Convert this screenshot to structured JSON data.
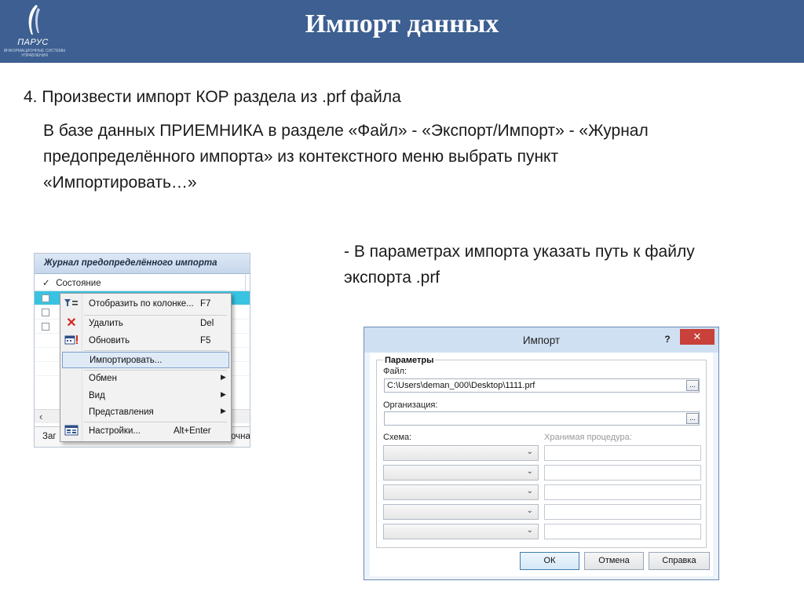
{
  "header": {
    "title": "Импорт данных",
    "logo": {
      "brand": "ПАРУС",
      "tagline": "ИНФОРМАЦИОННЫЕ СИСТЕМЫ УПРАВЛЕНИЯ"
    },
    "background": "#3d5f91"
  },
  "content": {
    "step": "4. Произвести импорт КОР раздела из .prf файла",
    "description_lines": [
      "В базе данных ПРИЕМНИКА в разделе «Файл» - «Экспорт/Импорт» - «Журнал",
      "предопределённого импорта» из контекстного меню выбрать пункт",
      "«Импортировать…»"
    ],
    "params_lines": [
      "- В параметрах импорта указать путь к файлу",
      "экспорта .prf"
    ]
  },
  "journal": {
    "title": "Журнал предопределённого импорта",
    "column_check": "✓",
    "column_header": "Состояние",
    "tab_left": "Заг",
    "tab_right": "очна"
  },
  "context_menu": {
    "items": [
      {
        "label": "Отобразить по колонке...",
        "shortcut": "F7",
        "icon": "filter-icon"
      },
      {
        "label": "Удалить",
        "shortcut": "Del",
        "icon": "delete-x-icon"
      },
      {
        "label": "Обновить",
        "shortcut": "F5",
        "icon": "refresh-calendar-icon"
      },
      {
        "label": "Импортировать...",
        "shortcut": "",
        "icon": ""
      },
      {
        "label": "Обмен",
        "shortcut": "",
        "icon": ""
      },
      {
        "label": "Вид",
        "shortcut": "",
        "icon": ""
      },
      {
        "label": "Представления",
        "shortcut": "",
        "icon": ""
      },
      {
        "label": "Настройки...",
        "shortcut": "Alt+Enter",
        "icon": "settings-icon"
      }
    ],
    "highlight_color": "#dfeaf7"
  },
  "import_dialog": {
    "title": "Импорт",
    "help": "?",
    "close": "✕",
    "group_title": "Параметры",
    "file_label": "Файл:",
    "file_value": "C:\\Users\\deman_000\\Desktop\\1111.prf",
    "org_label": "Организация:",
    "org_value": "",
    "schema_label": "Схема:",
    "proc_label": "Хранимая процедура:",
    "browse": "...",
    "buttons": {
      "ok": "ОК",
      "cancel": "Отмена",
      "help": "Справка"
    },
    "close_color": "#c8413a"
  }
}
